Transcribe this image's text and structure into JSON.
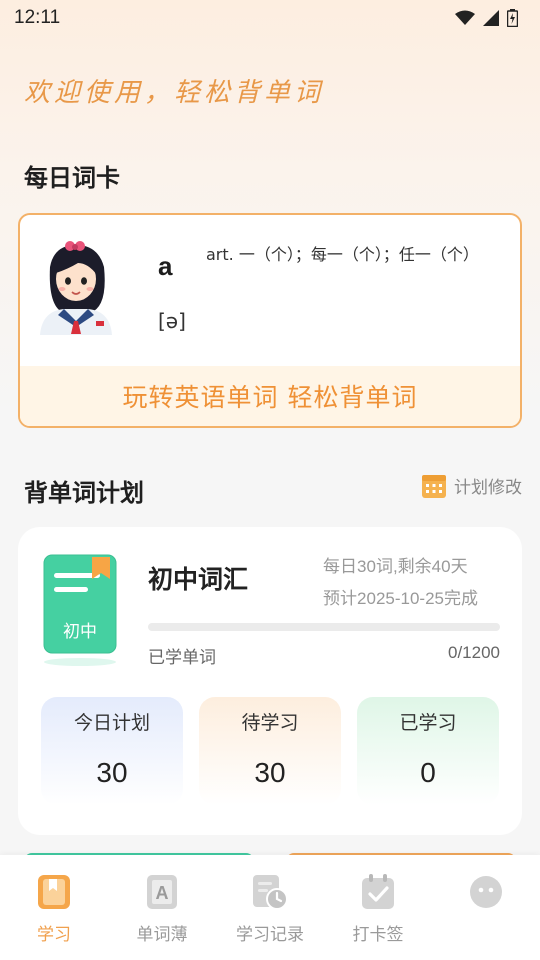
{
  "status_bar": {
    "time": "12:11"
  },
  "welcome_text": "欢迎使用，轻松背单词",
  "daily_card": {
    "section_title": "每日词卡",
    "word": "a",
    "definition": "art. 一（个）；每一（个）；任一（个）",
    "phonetic": "[ə]",
    "slogan": "玩转英语单词  轻松背单词"
  },
  "plan": {
    "section_title": "背单词计划",
    "edit_label": "计划修改",
    "book_label": "初中",
    "name": "初中词汇",
    "daily_info": "每日30词,剩余40天",
    "eta_info": "预计2025-10-25完成",
    "learned_label": "已学单词",
    "learned_count": "0/1200",
    "progress_fraction": 0,
    "stats": [
      {
        "label": "今日计划",
        "value": "30"
      },
      {
        "label": "待学习",
        "value": "30"
      },
      {
        "label": "已学习",
        "value": "0"
      }
    ]
  },
  "tabs": [
    {
      "label": "学习",
      "icon": "book-icon",
      "active": true
    },
    {
      "label": "单词薄",
      "icon": "vocabulary-icon",
      "active": false
    },
    {
      "label": "学习记录",
      "icon": "history-icon",
      "active": false
    },
    {
      "label": "打卡签",
      "icon": "checkin-calendar-icon",
      "active": false
    },
    {
      "label": "",
      "icon": "profile-icon",
      "active": false
    }
  ],
  "colors": {
    "accent": "#f0a04e",
    "slogan": "#ef9136",
    "welcome": "#e89848",
    "progress": "#49d7a8",
    "book": "#45d0a1"
  }
}
